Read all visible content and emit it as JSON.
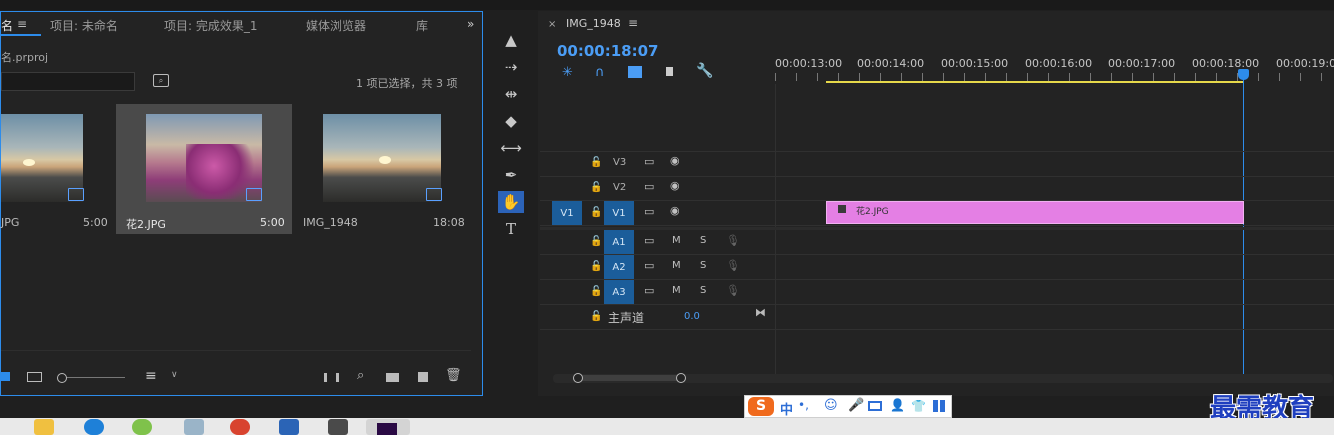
{
  "project_panel": {
    "tabs": [
      {
        "label": "名"
      },
      {
        "label": "项目: 未命名"
      },
      {
        "label": "项目: 完成效果_1"
      },
      {
        "label": "媒体浏览器"
      },
      {
        "label": "库"
      }
    ],
    "file_name": "名.prproj",
    "selection_status": "1 项已选择，共 3 项",
    "clips": [
      {
        "name": "JPG",
        "duration": "5:00"
      },
      {
        "name": "花2.JPG",
        "duration": "5:00"
      },
      {
        "name": "IMG_1948",
        "duration": "18:08"
      }
    ]
  },
  "timeline": {
    "sequence_name": "IMG_1948",
    "current_time": "00:00:18:07",
    "ruler_labels": [
      "00:00:13:00",
      "00:00:14:00",
      "00:00:15:00",
      "00:00:16:00",
      "00:00:17:00",
      "00:00:18:00",
      "00:00:19:00"
    ],
    "video_tracks": [
      {
        "label": "V3"
      },
      {
        "label": "V2"
      },
      {
        "label": "V1",
        "source": "V1"
      }
    ],
    "audio_tracks": [
      {
        "label": "A1",
        "mute": "M",
        "solo": "S"
      },
      {
        "label": "A2",
        "mute": "M",
        "solo": "S"
      },
      {
        "label": "A3",
        "mute": "M",
        "solo": "S"
      }
    ],
    "master": {
      "label": "主声道",
      "value": "0.0"
    },
    "clip": {
      "name": "花2.JPG",
      "color": "#e47fe4"
    },
    "playhead_color": "#2d8ceb"
  },
  "ime_toolbar": {
    "lang": "中",
    "punct": "•,"
  },
  "watermark": "最需教育"
}
